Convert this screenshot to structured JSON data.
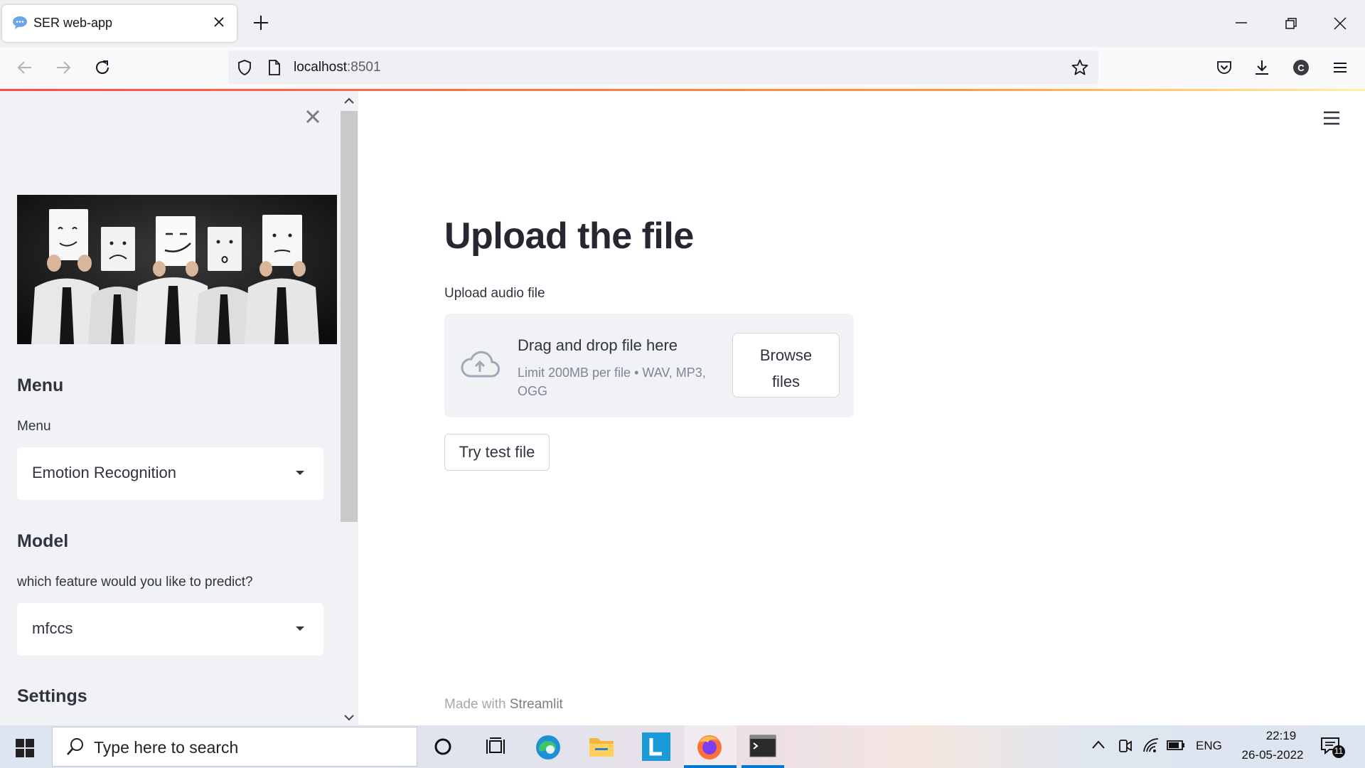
{
  "browser": {
    "tab_title": "SER web-app",
    "url_host": "localhost",
    "url_port": ":8501"
  },
  "sidebar": {
    "menu_heading": "Menu",
    "menu_label": "Menu",
    "menu_selected": "Emotion Recognition",
    "model_heading": "Model",
    "model_label": "which feature would you like to predict?",
    "model_selected": "mfccs",
    "settings_heading": "Settings"
  },
  "main": {
    "title": "Upload the file",
    "upload_label": "Upload audio file",
    "dropzone_title": "Drag and drop file here",
    "dropzone_limit": "Limit 200MB per file • WAV, MP3, OGG",
    "browse_line1": "Browse",
    "browse_line2": "files",
    "try_button": "Try test file",
    "footer_prefix": "Made with ",
    "footer_brand": "Streamlit"
  },
  "taskbar": {
    "search_placeholder": "Type here to search",
    "language": "ENG",
    "time": "22:19",
    "date": "26-05-2022",
    "notification_count": "11"
  },
  "colors": {
    "streamlit_red": "#ff4b4b",
    "sidebar_bg": "#f0f2f6",
    "text": "#31333f",
    "taskbar_accent": "#0078d4"
  }
}
